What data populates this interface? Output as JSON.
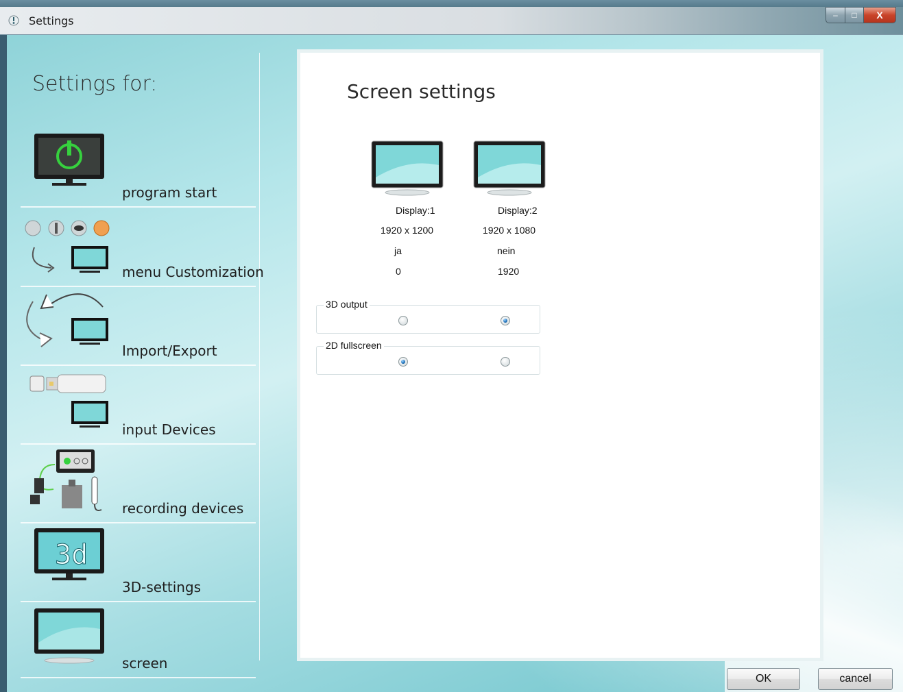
{
  "window": {
    "title": "Settings",
    "controls": {
      "minimize": "–",
      "maximize": "□",
      "close": "X"
    }
  },
  "sidebar": {
    "title": "Settings for:",
    "items": [
      {
        "label": "program start",
        "icon": "power-monitor-icon"
      },
      {
        "label": "menu Customization",
        "icon": "menu-customization-icon"
      },
      {
        "label": "Import/Export",
        "icon": "import-export-icon"
      },
      {
        "label": "input Devices",
        "icon": "usb-monitor-icon"
      },
      {
        "label": "recording devices",
        "icon": "recording-devices-icon"
      },
      {
        "label": "3D-settings",
        "icon": "3d-monitor-icon"
      },
      {
        "label": "screen",
        "icon": "screen-monitor-icon"
      }
    ]
  },
  "panel": {
    "title": "Screen settings",
    "displays": [
      {
        "name": "Display:1",
        "resolution": "1920 x 1200",
        "primary": "ja",
        "offset": "0"
      },
      {
        "name": "Display:2",
        "resolution": "1920 x 1080",
        "primary": "nein",
        "offset": "1920"
      }
    ],
    "groups": [
      {
        "label": "3D output",
        "selected": 2
      },
      {
        "label": "2D fullscreen",
        "selected": 1
      }
    ]
  },
  "buttons": {
    "ok": "OK",
    "cancel": "cancel"
  },
  "colors": {
    "accent": "#6cc3cb",
    "radio_selected": "#1c6fb8"
  }
}
